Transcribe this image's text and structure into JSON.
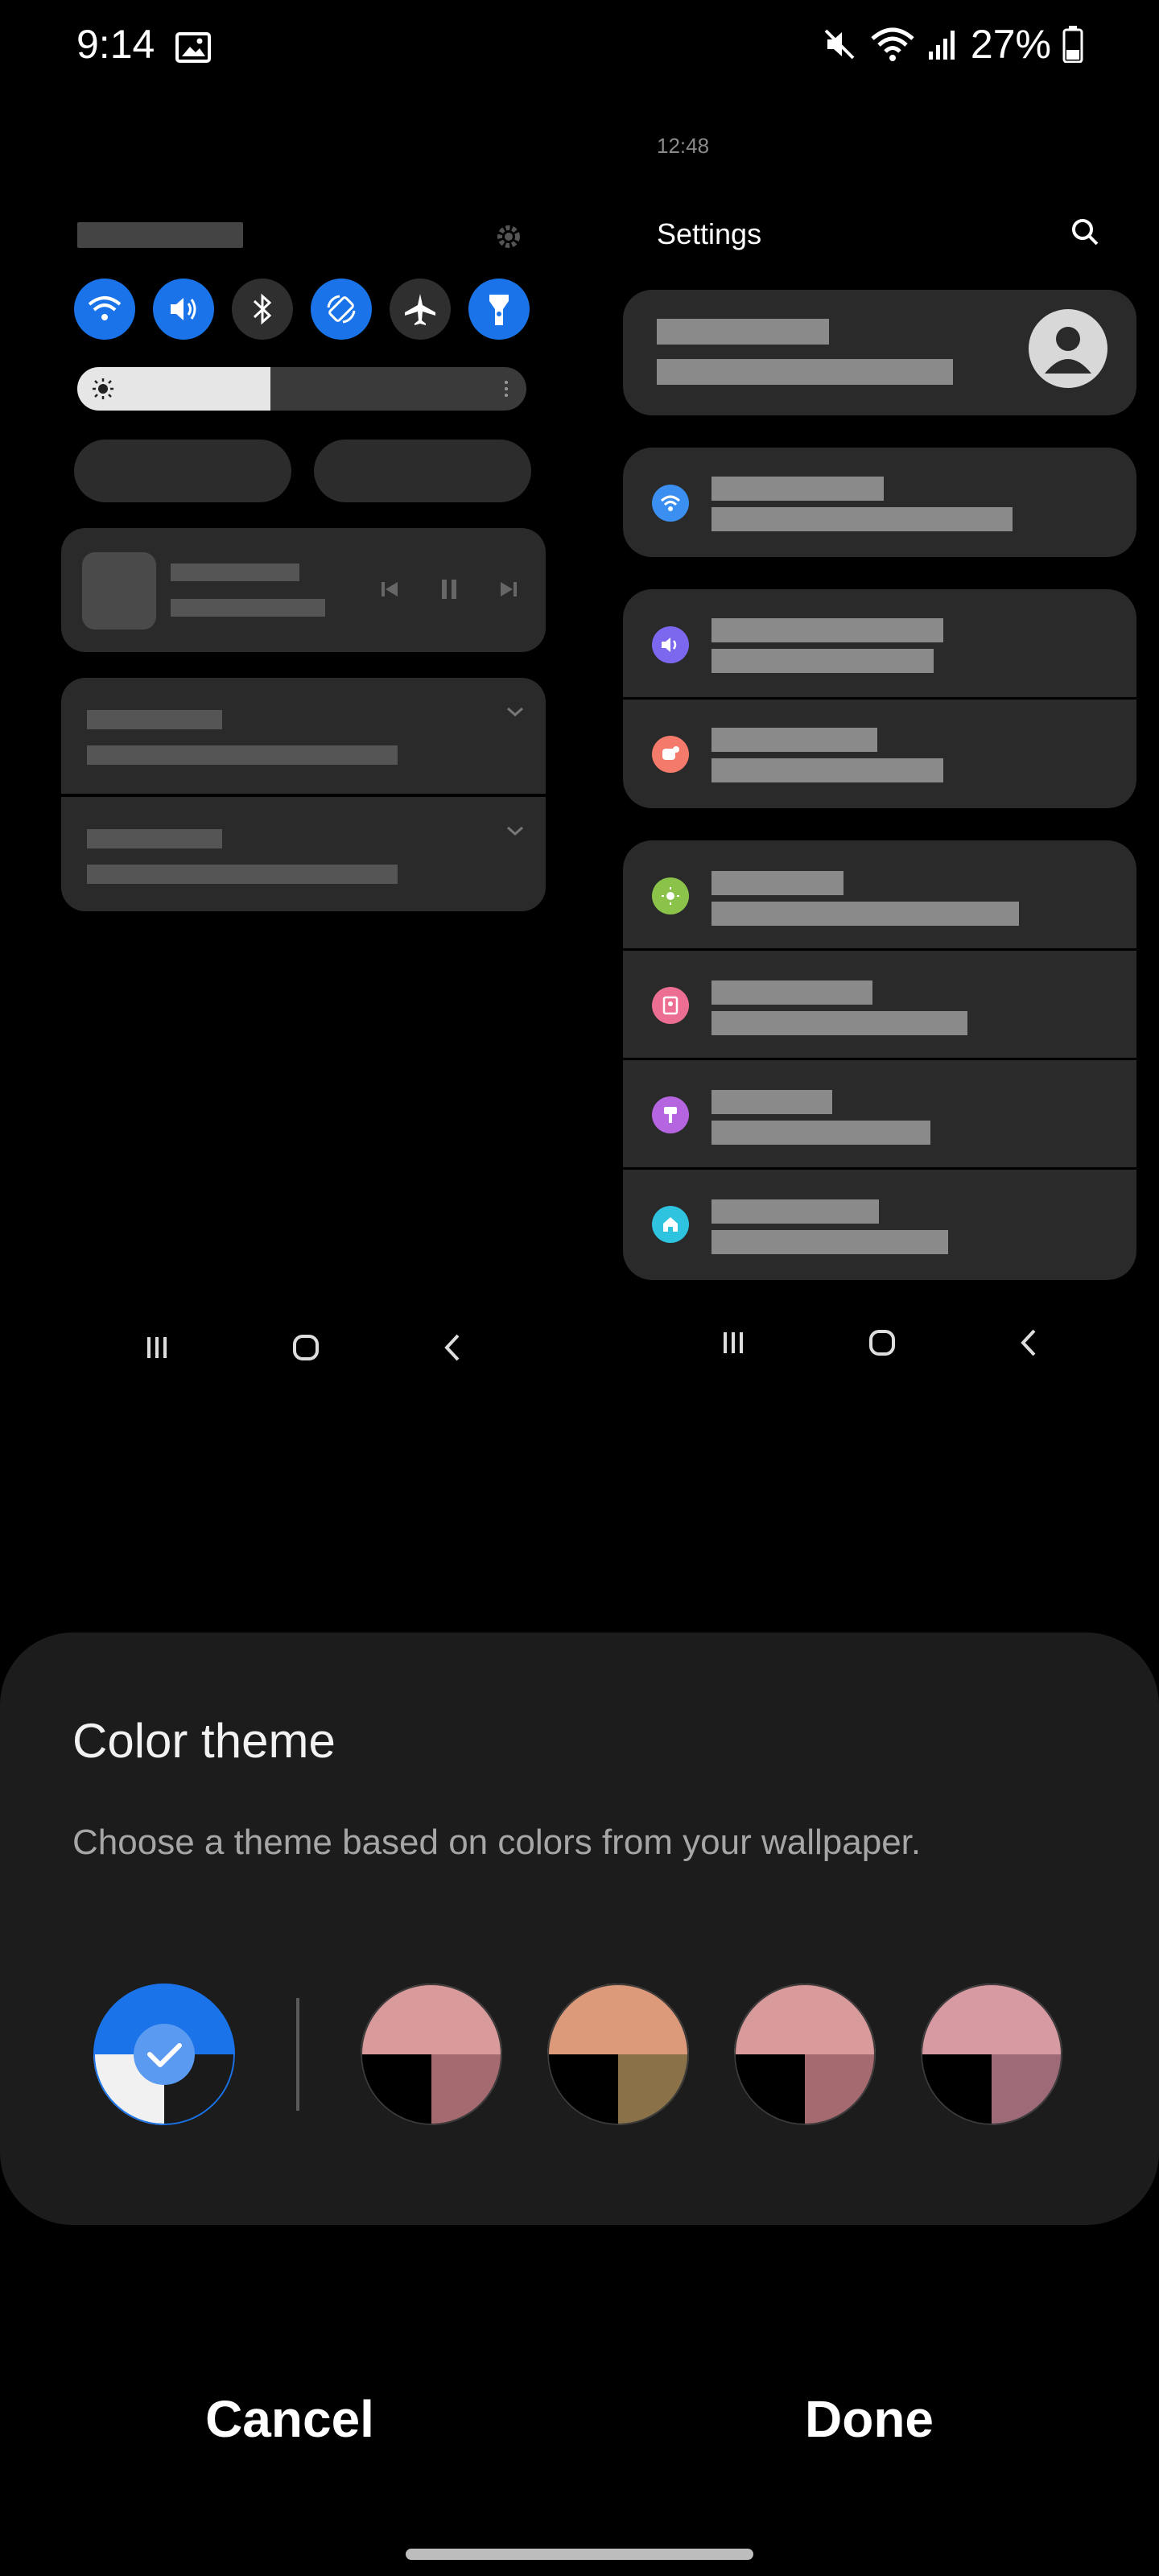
{
  "status_bar": {
    "time": "9:14",
    "battery_percent": "27%",
    "icons": [
      "image-icon",
      "mute-icon",
      "wifi-icon",
      "signal-icon",
      "battery-icon"
    ]
  },
  "preview_quick_panel": {
    "toggles": [
      {
        "icon": "wifi-icon",
        "on": true
      },
      {
        "icon": "sound-icon",
        "on": true
      },
      {
        "icon": "bluetooth-icon",
        "on": false
      },
      {
        "icon": "auto-rotate-icon",
        "on": true
      },
      {
        "icon": "airplane-icon",
        "on": false
      },
      {
        "icon": "flashlight-icon",
        "on": true
      }
    ],
    "brightness_level": 0.43
  },
  "preview_settings": {
    "time": "12:48",
    "title": "Settings"
  },
  "color_theme_sheet": {
    "title": "Color theme",
    "description": "Choose a theme based on colors from your wallpaper.",
    "selected_index": 0,
    "swatches": [
      {
        "name": "default-blue",
        "top": "#1a73e8",
        "bottom_left": "#f1f1f1",
        "bottom_right": "#1a1a1a",
        "check": true
      },
      {
        "name": "wallpaper-1",
        "top": "#d89a9a",
        "bottom_left": "#000000",
        "bottom_right": "#a56a70"
      },
      {
        "name": "wallpaper-2",
        "top": "#dc9a7a",
        "bottom_left": "#000000",
        "bottom_right": "#8a7148"
      },
      {
        "name": "wallpaper-3",
        "top": "#d89a9a",
        "bottom_left": "#000000",
        "bottom_right": "#a56a70"
      },
      {
        "name": "wallpaper-4",
        "top": "#d89aa2",
        "bottom_left": "#000000",
        "bottom_right": "#9e6a78"
      }
    ]
  },
  "buttons": {
    "cancel": "Cancel",
    "done": "Done"
  },
  "colors": {
    "accent": "#1a73e8",
    "sheet_background": "#1c1c1c"
  }
}
